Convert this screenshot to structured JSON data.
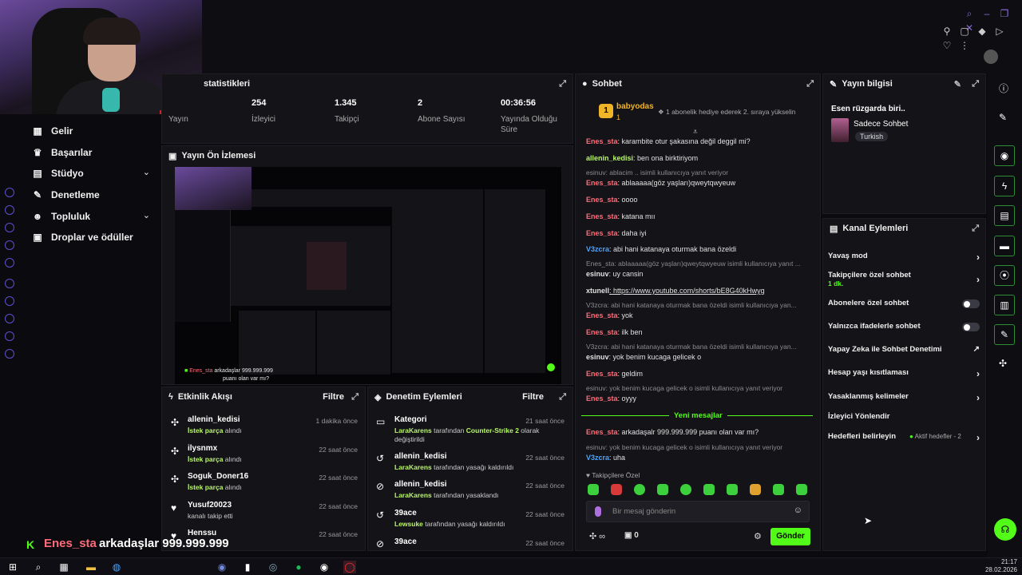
{
  "stats": {
    "title": "statistikleri",
    "items": [
      {
        "value": "",
        "label": "Yayın"
      },
      {
        "value": "254",
        "label": "İzleyici"
      },
      {
        "value": "1.345",
        "label": "Takipçi"
      },
      {
        "value": "2",
        "label": "Abone Sayısı"
      },
      {
        "value": "00:36:56",
        "label": "Yayında Olduğu Süre"
      }
    ]
  },
  "sidebar": {
    "items": [
      {
        "label": "Gelir",
        "icon": "chart-icon"
      },
      {
        "label": "Başarılar",
        "icon": "trophy-icon"
      },
      {
        "label": "Stüdyo",
        "icon": "studio-icon"
      },
      {
        "label": "Denetleme",
        "icon": "wrench-icon"
      },
      {
        "label": "Topluluk",
        "icon": "users-icon"
      },
      {
        "label": "Droplar ve ödüller",
        "icon": "gift-icon"
      }
    ]
  },
  "preview": {
    "title": "Yayın Ön İzlemesi",
    "overlay_text_1": "Enes_sta",
    "overlay_text_2": "arkadaşlar 999.999.999",
    "overlay_text_3": "puanı olan var mı?"
  },
  "chat": {
    "title": "Sohbet",
    "pinned_user": "babyodas",
    "pinned_count": "1",
    "pinned_text": "1 abonelik hediye ederek 2. sıraya yükselin",
    "new_messages": "Yeni mesajlar",
    "followers_only": "Takipçilere Özel",
    "placeholder": "Bir mesaj gönderin",
    "send": "Gönder",
    "points": "∞",
    "count": "0"
  },
  "chat_lines": [
    {
      "type": "msg",
      "user": "Enes_sta",
      "color": "red",
      "text": ": karambite otur şakasına değil deggil mi?"
    },
    {
      "type": "msg",
      "user": "allenin_kedisi",
      "color": "green",
      "text": ": ben ona birktiriyom"
    },
    {
      "type": "reply",
      "text": "esinuv: ablacim .. isimli kullanıcıya yanıt veriyor"
    },
    {
      "type": "msg",
      "user": "Enes_sta",
      "color": "red",
      "text": ": ablaaaaa(göz yaşları)qweytqwyeuw"
    },
    {
      "type": "msg",
      "user": "Enes_sta",
      "color": "red",
      "text": ": oooo"
    },
    {
      "type": "msg",
      "user": "Enes_sta",
      "color": "red",
      "text": ": katana mıı"
    },
    {
      "type": "msg",
      "user": "Enes_sta",
      "color": "red",
      "text": ": daha iyi"
    },
    {
      "type": "msg",
      "user": "V3zcra",
      "color": "blue",
      "text": ": abi hani katanaya oturmak bana özeldi"
    },
    {
      "type": "reply",
      "text": "Enes_sta: ablaaaaa(göz yaşları)qweytqwyeuw isimli kullanıcıya yanıt ..."
    },
    {
      "type": "msg",
      "user": "esinuv",
      "color": "white",
      "text": ": uy cansin"
    },
    {
      "type": "msg",
      "user": "xtunell",
      "color": "white",
      "text": ": https://www.youtube.com/shorts/bE8G40kHwyg"
    },
    {
      "type": "reply",
      "text": "V3zcra: abi hani katanaya oturmak bana özeldi isimli kullanıcıya yan..."
    },
    {
      "type": "msg",
      "user": "Enes_sta",
      "color": "red",
      "text": ": yok"
    },
    {
      "type": "msg",
      "user": "Enes_sta",
      "color": "red",
      "text": ": ilk ben"
    },
    {
      "type": "reply",
      "text": "V3zcra: abi hani katanaya oturmak bana özeldi isimli kullanıcıya yan..."
    },
    {
      "type": "msg",
      "user": "esinuv",
      "color": "white",
      "text": ": yok benim kucaga gelicek o"
    },
    {
      "type": "msg",
      "user": "Enes_sta",
      "color": "red",
      "text": ": geldim"
    },
    {
      "type": "reply",
      "text": "esinuv: yok benim kucaga gelicek o isimli kullanıcıya yanıt veriyor"
    },
    {
      "type": "msg",
      "user": "Enes_sta",
      "color": "red",
      "text": ": oyyy"
    },
    {
      "type": "msg",
      "user": "Enes_sta",
      "color": "red",
      "text": ": arkadaşalr 999.999.999 puanı olan var mı?"
    },
    {
      "type": "reply",
      "text": "esinuv: yok benim kucaga gelicek o isimli kullanıcıya yanıt veriyor"
    },
    {
      "type": "msg",
      "user": "V3zcra",
      "color": "blue",
      "text": ": uha"
    }
  ],
  "activity": {
    "title": "Etkinlik Akışı",
    "filter": "Filtre",
    "rows": [
      {
        "name": "allenin_kedisi",
        "sub_b": "İstek parça",
        "sub": " alındı",
        "time": "1 dakika önce",
        "icon": "puzzle-icon"
      },
      {
        "name": "ilysnmx",
        "sub_b": "İstek parça",
        "sub": " alındı",
        "time": "22 saat önce",
        "icon": "puzzle-icon"
      },
      {
        "name": "Soguk_Doner16",
        "sub_b": "İstek parça",
        "sub": " alındı",
        "time": "22 saat önce",
        "icon": "puzzle-icon"
      },
      {
        "name": "Yusuf20023",
        "sub_b": "",
        "sub": "kanalı takip etti",
        "time": "22 saat önce",
        "icon": "heart-icon"
      },
      {
        "name": "Henssu",
        "sub_b": "",
        "sub": "",
        "time": "22 saat önce",
        "icon": "heart-icon"
      }
    ]
  },
  "moderation": {
    "title": "Denetim Eylemleri",
    "filter": "Filtre",
    "rows": [
      {
        "name": "Kategori",
        "sub_b": "LaraKarens",
        "sub": " tarafından ",
        "sub_b2": "Counter-Strike 2",
        "sub2": " olarak değiştirildi",
        "time": "21 saat önce",
        "icon": "category-icon"
      },
      {
        "name": "allenin_kedisi",
        "sub_b": "LaraKarens",
        "sub": " tarafından yasağı kaldırıldı",
        "sub_b2": "",
        "sub2": "",
        "time": "22 saat önce",
        "icon": "undo-icon"
      },
      {
        "name": "allenin_kedisi",
        "sub_b": "LaraKarens",
        "sub": " tarafından yasaklandı",
        "sub_b2": "",
        "sub2": "",
        "time": "22 saat önce",
        "icon": "ban-icon"
      },
      {
        "name": "39ace",
        "sub_b": "Lewsuke",
        "sub": " tarafından yasağı kaldırıldı",
        "sub_b2": "",
        "sub2": "",
        "time": "22 saat önce",
        "icon": "undo-icon"
      },
      {
        "name": "39ace",
        "sub_b": "",
        "sub": "",
        "sub_b2": "",
        "sub2": "",
        "time": "22 saat önce",
        "icon": "ban-icon"
      }
    ]
  },
  "stream_info": {
    "title": "Yayın bilgisi",
    "stream_title": "Esen rüzgarda biri..",
    "category": "Sadece Sohbet",
    "tag": "Turkish"
  },
  "channel_actions": {
    "title": "Kanal Eylemleri",
    "items": [
      {
        "label": "Yavaş mod",
        "control": "arrow"
      },
      {
        "label": "Takipçilere özel sohbet",
        "extra": "1 dk.",
        "control": "arrow"
      },
      {
        "label": "Abonelere özel sohbet",
        "control": "toggle"
      },
      {
        "label": "Yalnızca ifadelerle sohbet",
        "control": "toggle"
      },
      {
        "label": "Yapay Zeka ile Sohbet Denetimi",
        "control": "external"
      },
      {
        "label": "Hesap yaşı kısıtlaması",
        "control": "arrow"
      },
      {
        "label": "Yasaklanmış kelimeler",
        "control": "arrow"
      },
      {
        "label": "İzleyici Yönlendir",
        "control": "none"
      },
      {
        "label": "Hedefleri belirleyin",
        "extra": "Aktif hedefler - 2",
        "control": "arrow"
      }
    ]
  },
  "taskbar": {
    "time": "21:17",
    "date": "28.02.2026"
  },
  "colors": {
    "accent": "#53fc18",
    "panel": "#141418",
    "bg": "#0b0b0f"
  }
}
